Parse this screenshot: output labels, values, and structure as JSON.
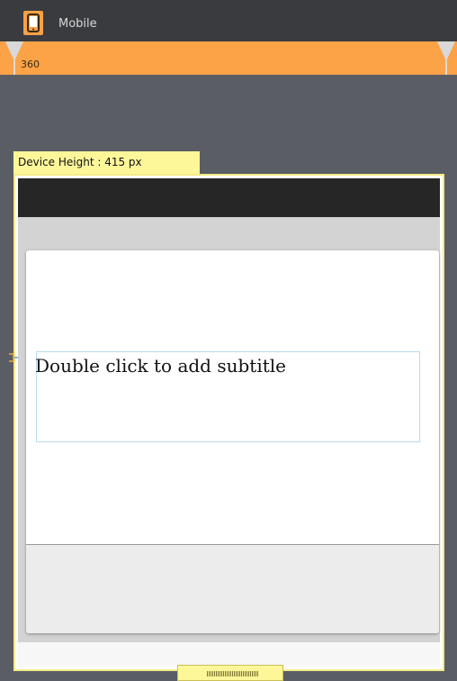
{
  "device_tab": {
    "label": "Mobile",
    "icon": "mobile-phone-icon",
    "accent_color": "#f7a145"
  },
  "ruler": {
    "value": "360",
    "color": "#fba346"
  },
  "device": {
    "height_label": "Device Height : 415 px"
  },
  "dialog": {
    "subtitle_placeholder": "Double click to add subtitle"
  }
}
